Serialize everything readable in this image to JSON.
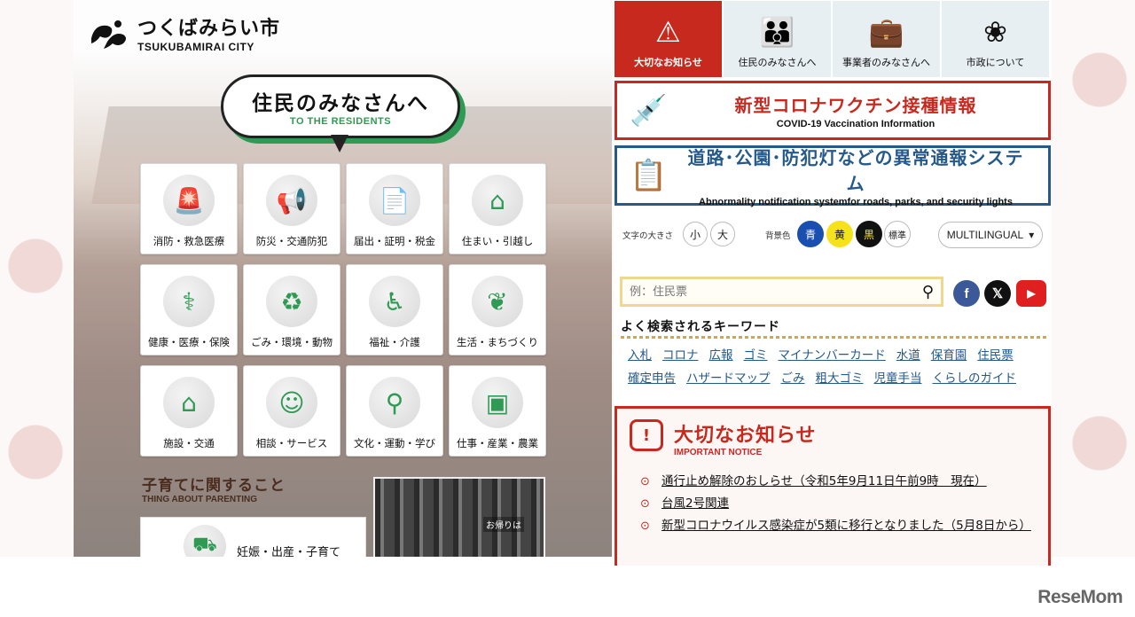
{
  "header": {
    "logo_jp": "つくばみらい市",
    "logo_en": "TSUKUBAMIRAI CITY"
  },
  "residents": {
    "title_jp": "住民のみなさんへ",
    "title_en": "TO THE RESIDENTS",
    "categories": [
      {
        "label": "消防・救急医療",
        "icon": "siren-icon",
        "glyph": "🚨"
      },
      {
        "label": "防災・交通防犯",
        "icon": "megaphone-icon",
        "glyph": "📢"
      },
      {
        "label": "届出・証明・税金",
        "icon": "document-icon",
        "glyph": "📄"
      },
      {
        "label": "住まい・引越し",
        "icon": "house-icon",
        "glyph": "⌂"
      },
      {
        "label": "健康・医療・保険",
        "icon": "stethoscope-icon",
        "glyph": "⚕"
      },
      {
        "label": "ごみ・環境・動物",
        "icon": "recycle-icon",
        "glyph": "♻"
      },
      {
        "label": "福祉・介護",
        "icon": "wheelchair-icon",
        "glyph": "♿"
      },
      {
        "label": "生活・まちづくり",
        "icon": "tree-icon",
        "glyph": "❦"
      },
      {
        "label": "施設・交通",
        "icon": "building-icon",
        "glyph": "⌂"
      },
      {
        "label": "相談・サービス",
        "icon": "counter-icon",
        "glyph": "☺"
      },
      {
        "label": "文化・運動・学び",
        "icon": "bicycle-icon",
        "glyph": "⚲"
      },
      {
        "label": "仕事・産業・農業",
        "icon": "briefcase-icon",
        "glyph": "▣"
      }
    ]
  },
  "parenting": {
    "title_jp": "子育てに関すること",
    "title_en": "THING ABOUT PARENTING",
    "card_label": "妊娠・出産・子育て",
    "card_icon": "stroller-icon",
    "photo_sign": "お帰りは"
  },
  "top_nav": [
    {
      "label": "大切なお知らせ",
      "icon": "warning-icon",
      "glyph": "⚠"
    },
    {
      "label": "住民のみなさんへ",
      "icon": "family-icon",
      "glyph": "👪"
    },
    {
      "label": "事業者のみなさんへ",
      "icon": "briefcase-icon",
      "glyph": "💼"
    },
    {
      "label": "市政について",
      "icon": "city-logo-icon",
      "glyph": "❀"
    }
  ],
  "banners": {
    "vaccine": {
      "jp": "新型コロナワクチン接種情報",
      "en": "COVID-19 Vaccination Information"
    },
    "report": {
      "jp": "道路･公園･防犯灯などの異常通報システム",
      "en": "Abnormality notification systemfor roads, parks, and security lights"
    }
  },
  "tools": {
    "font_size_label": "文字の大きさ",
    "font_small": "小",
    "font_large": "大",
    "bg_label": "背景色",
    "bg_blue": "青",
    "bg_yellow": "黄",
    "bg_black": "黒",
    "bg_standard": "標準",
    "multilingual": "MULTILINGUAL"
  },
  "search": {
    "placeholder": "例：住民票"
  },
  "keywords": {
    "title": "よく検索されるキーワード",
    "items": [
      "入札",
      "コロナ",
      "広報",
      "ゴミ",
      "マイナンバーカード",
      "水道",
      "保育園",
      "住民票",
      "確定申告",
      "ハザードマップ",
      "ごみ",
      "粗大ゴミ",
      "児童手当",
      "くらしのガイド"
    ]
  },
  "notice": {
    "title_jp": "大切なお知らせ",
    "title_en": "IMPORTANT NOTICE",
    "items": [
      "通行止め解除のおしらせ（令和5年9月11日午前9時　現在）",
      "台風2号関連",
      "新型コロナウイルス感染症が5類に移行となりました（5月8日から）"
    ]
  },
  "watermark": "ReseMom",
  "colors": {
    "accent_red": "#c8291f",
    "accent_green": "#2f9a54",
    "accent_blue": "#25598a",
    "bg_blue": "#1a4fb0",
    "bg_yellow": "#f5e21a",
    "bg_black": "#111111"
  }
}
